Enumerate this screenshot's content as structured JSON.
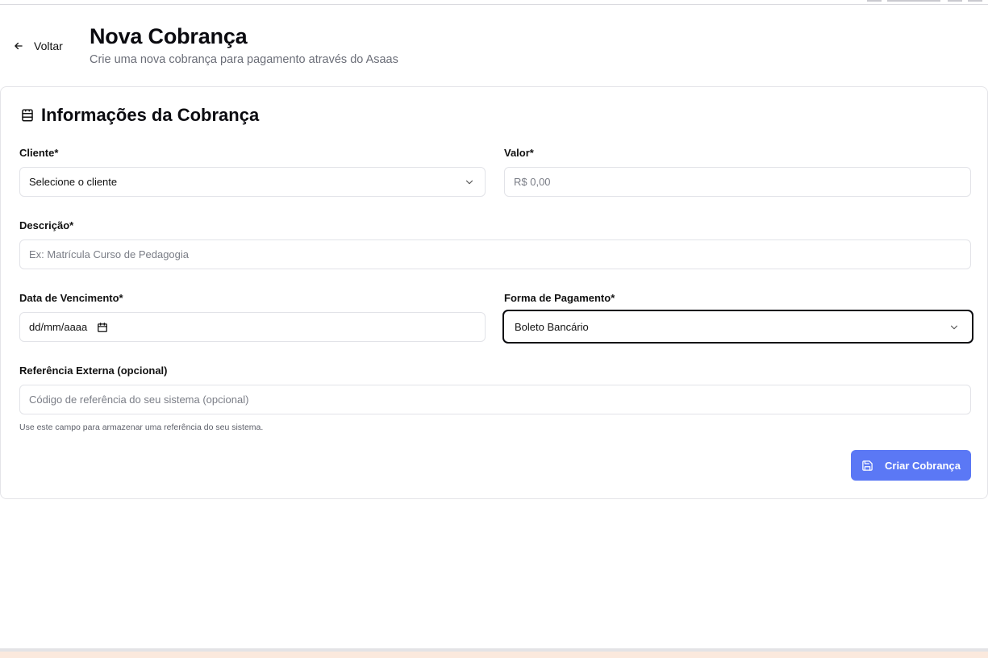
{
  "header": {
    "back_label": "Voltar",
    "title": "Nova Cobrança",
    "subtitle": "Crie uma nova cobrança para pagamento através do Asaas"
  },
  "card": {
    "title": "Informações da Cobrança",
    "title_icon": "receipt-icon"
  },
  "form": {
    "cliente": {
      "label": "Cliente*",
      "value": "Selecione o cliente"
    },
    "valor": {
      "label": "Valor*",
      "placeholder": "R$ 0,00"
    },
    "descricao": {
      "label": "Descrição*",
      "placeholder": "Ex: Matrícula Curso de Pedagogia"
    },
    "vencimento": {
      "label": "Data de Vencimento*",
      "value": "dd/mm/aaaa"
    },
    "pagamento": {
      "label": "Forma de Pagamento*",
      "value": "Boleto Bancário"
    },
    "referencia": {
      "label": "Referência Externa (opcional)",
      "placeholder": "Código de referência do seu sistema (opcional)",
      "hint": "Use este campo para armazenar uma referência do seu sistema."
    },
    "submit_label": "Criar Cobrança"
  },
  "colors": {
    "accent": "#5b78f5",
    "border": "#e2e3e8",
    "text_muted": "#6b6e78"
  }
}
